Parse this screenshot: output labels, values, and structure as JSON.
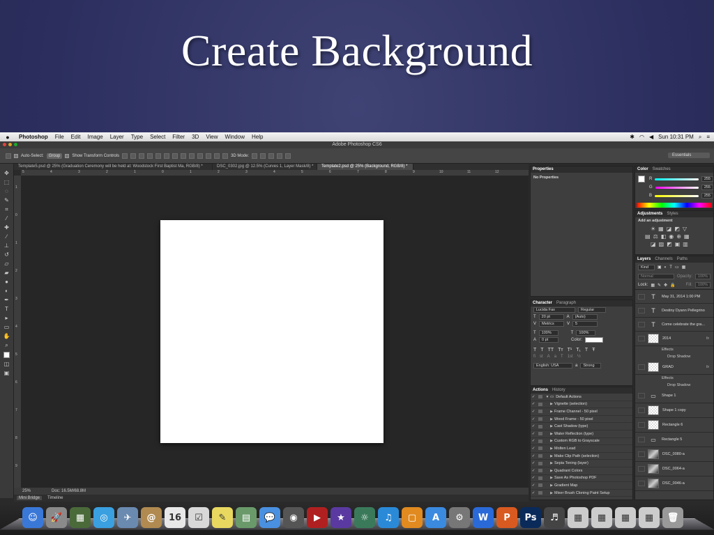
{
  "slide": {
    "title": "Create Background"
  },
  "menubar": {
    "app": "Photoshop",
    "items": [
      "File",
      "Edit",
      "Image",
      "Layer",
      "Type",
      "Select",
      "Filter",
      "3D",
      "View",
      "Window",
      "Help"
    ],
    "clock": "Sun 10:31 PM"
  },
  "window": {
    "title": "Adobe Photoshop CS6"
  },
  "options": {
    "auto_select_label": "Auto-Select:",
    "auto_select_value": "Group",
    "show_transform_label": "Show Transform Controls",
    "mode_3d_label": "3D Mode:",
    "workspace": "Essentials"
  },
  "tabs": [
    {
      "label": "Template5.psd @ 25% (Graduation Ceremony will be held at: Woodstock First Baptist Ma, RGB/8) *"
    },
    {
      "label": "DSC_0302.jpg @ 12.5% (Curves 1, Layer Mask/8) *"
    },
    {
      "label": "Template2.psd @ 25% (Background, RGB/8) *"
    }
  ],
  "ruler_h": [
    "5",
    "4",
    "3",
    "2",
    "1",
    "0",
    "1",
    "2",
    "3",
    "4",
    "5",
    "6",
    "7",
    "8",
    "9",
    "10",
    "11",
    "12"
  ],
  "ruler_v": [
    "1",
    "0",
    "1",
    "2",
    "3",
    "4",
    "5",
    "6",
    "7",
    "8",
    "9"
  ],
  "status": {
    "zoom": "25%",
    "doc": "Doc: 16.5M/68.8M"
  },
  "bottom_tabs": [
    "Mini Bridge",
    "Timeline"
  ],
  "properties": {
    "tab": "Properties",
    "body": "No Properties"
  },
  "color": {
    "tabs": [
      "Color",
      "Swatches"
    ],
    "channels": [
      {
        "label": "R",
        "value": "255"
      },
      {
        "label": "G",
        "value": "255"
      },
      {
        "label": "B",
        "value": "255"
      }
    ]
  },
  "adjustments": {
    "tabs": [
      "Adjustments",
      "Styles"
    ],
    "heading": "Add an adjustment"
  },
  "layers_panel": {
    "tabs": [
      "Layers",
      "Channels",
      "Paths"
    ],
    "kind": "Kind",
    "blend": "Normal",
    "opacity_label": "Opacity:",
    "opacity": "100%",
    "lock_label": "Lock:",
    "fill_label": "Fill:",
    "fill": "100%",
    "fx": "fx",
    "effects_label": "Effects",
    "drop_shadow_label": "Drop Shadow",
    "layers": [
      {
        "name": "May 31, 2014 1:00 PM",
        "kind": "T"
      },
      {
        "name": "Destiny Dyann Pellegrino",
        "kind": "T"
      },
      {
        "name": "Come celebrate the gra...",
        "kind": "T"
      },
      {
        "name": "2014",
        "kind": "thumb",
        "effects": true
      },
      {
        "name": "GRAD",
        "kind": "thumb",
        "effects": true
      },
      {
        "name": "Shape 1",
        "kind": "shape"
      },
      {
        "name": "Shape 1 copy",
        "kind": "thumb"
      },
      {
        "name": "Rectangle 6",
        "kind": "thumb"
      },
      {
        "name": "Rectangle 5",
        "kind": "shape"
      },
      {
        "name": "DSC_0080-a",
        "kind": "photo"
      },
      {
        "name": "DSC_0064-a",
        "kind": "photo"
      },
      {
        "name": "DSC_0046-a",
        "kind": "photo"
      }
    ]
  },
  "character": {
    "tabs": [
      "Character",
      "Paragraph"
    ],
    "font": "Lucida Fax",
    "style": "Regular",
    "size": "20 pt",
    "leading": "(Auto)",
    "kerning": "Metrics",
    "tracking": "5",
    "vscale": "100%",
    "hscale": "100%",
    "baseline": "0 pt",
    "color_label": "Color:",
    "language": "English: USA",
    "aa": "Strong"
  },
  "actions": {
    "tabs": [
      "Actions",
      "History"
    ],
    "set": "Default Actions",
    "items": [
      "Vignette (selection)",
      "Frame Channel - 50 pixel",
      "Wood Frame - 50 pixel",
      "Cast Shadow (type)",
      "Water Reflection (type)",
      "Custom RGB to Grayscale",
      "Molten Lead",
      "Make Clip Path (selection)",
      "Sepia Toning (layer)",
      "Quadrant Colors",
      "Save As Photoshop PDF",
      "Gradient Map",
      "Mixer Brush Cloning Paint Setup"
    ]
  },
  "dock": {
    "apps": [
      {
        "glyph": "☺",
        "color": "#3a78d8"
      },
      {
        "glyph": "🚀",
        "color": "#8a8a8a"
      },
      {
        "glyph": "▦",
        "color": "#4a6a3a"
      },
      {
        "glyph": "◎",
        "color": "#3aa0e0"
      },
      {
        "glyph": "✈",
        "color": "#6a8ab0"
      },
      {
        "glyph": "@",
        "color": "#b08a50"
      },
      {
        "glyph": "16",
        "color": "#e8e8e8"
      },
      {
        "glyph": "☑",
        "color": "#d8d8d8"
      },
      {
        "glyph": "✎",
        "color": "#e8d860"
      },
      {
        "glyph": "▤",
        "color": "#6a9a6a"
      },
      {
        "glyph": "💬",
        "color": "#4a90e0"
      },
      {
        "glyph": "◉",
        "color": "#555555"
      },
      {
        "glyph": "▶",
        "color": "#b02020"
      },
      {
        "glyph": "★",
        "color": "#5a3aa0"
      },
      {
        "glyph": "☼",
        "color": "#3a7a5a"
      },
      {
        "glyph": "♫",
        "color": "#2a8ad8"
      },
      {
        "glyph": "▢",
        "color": "#e08a20"
      },
      {
        "glyph": "A",
        "color": "#3a8ae0"
      },
      {
        "glyph": "⚙",
        "color": "#777777"
      },
      {
        "glyph": "W",
        "color": "#2a6ad8"
      },
      {
        "glyph": "P",
        "color": "#d85a20"
      },
      {
        "glyph": "Ps",
        "color": "#0a2a5a"
      },
      {
        "glyph": "♬",
        "color": "#444444"
      },
      {
        "glyph": "▦",
        "color": "#cccccc"
      },
      {
        "glyph": "▦",
        "color": "#cccccc"
      },
      {
        "glyph": "▦",
        "color": "#cccccc"
      },
      {
        "glyph": "▦",
        "color": "#cccccc"
      },
      {
        "glyph": "🗑",
        "color": "#999999"
      }
    ]
  }
}
